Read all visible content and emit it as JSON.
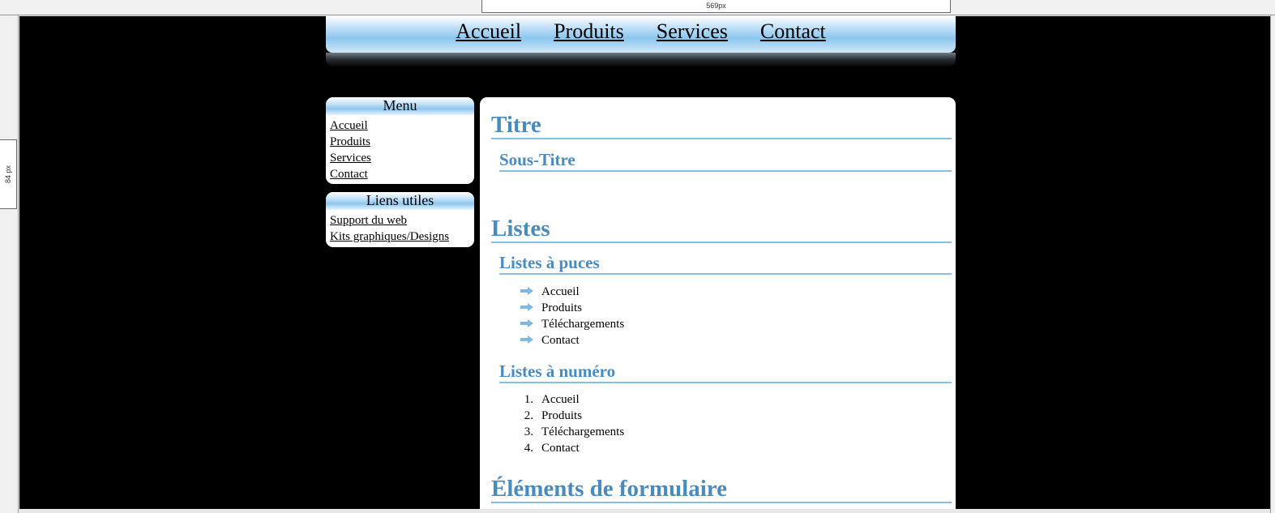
{
  "ruler": {
    "top_label": "569px",
    "left_label": "84 px"
  },
  "topnav": {
    "items": [
      "Accueil",
      "Produits",
      "Services",
      "Contact"
    ]
  },
  "sidebar": {
    "menu": {
      "title": "Menu",
      "items": [
        "Accueil",
        "Produits",
        "Services",
        "Contact"
      ]
    },
    "links": {
      "title": "Liens utiles",
      "items": [
        "Support du web",
        "Kits graphiques/Designs"
      ]
    }
  },
  "content": {
    "title": "Titre",
    "subtitle": "Sous-Titre",
    "lists_heading": "Listes",
    "bullets_heading": "Listes à puces",
    "bullets": [
      "Accueil",
      "Produits",
      "Téléchargements",
      "Contact"
    ],
    "numbered_heading": "Listes à numéro",
    "numbered": [
      "Accueil",
      "Produits",
      "Téléchargements",
      "Contact"
    ],
    "numbers": [
      "1.",
      "2.",
      "3.",
      "4."
    ],
    "form_heading": "Éléments de formulaire"
  },
  "colors": {
    "heading": "#4a8bbd",
    "rule": "#89bfe3",
    "page_bg": "#000000"
  },
  "icons": {
    "bullet": "arrow-right-icon"
  }
}
